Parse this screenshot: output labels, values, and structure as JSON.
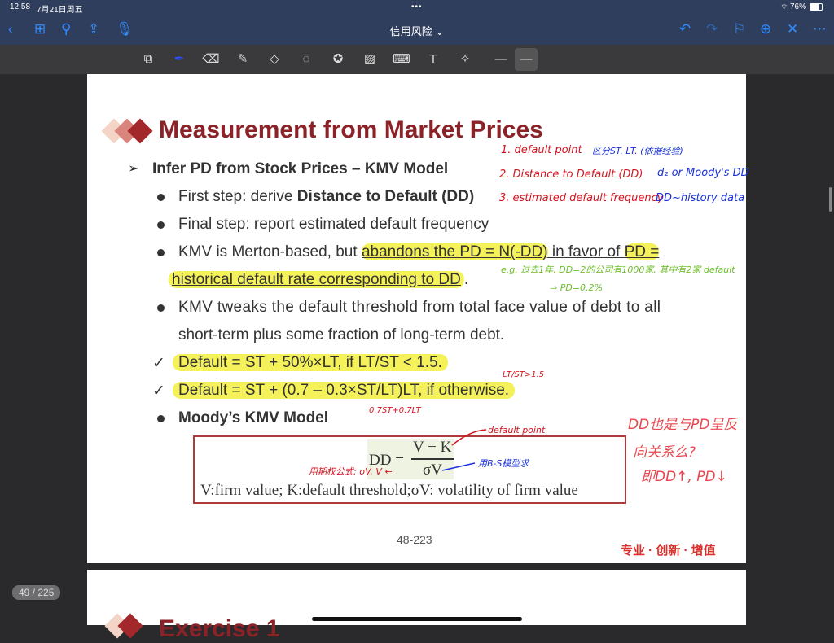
{
  "status": {
    "time": "12:58",
    "date": "7月21日周五",
    "battery": "76%"
  },
  "nav": {
    "title": "信用风险 ⌄"
  },
  "toolbar": {
    "colors": [
      "#ffffff",
      "#d40f0f",
      "#7ac943",
      "#1a1aff",
      "#b45cf5",
      "#ffffff",
      "#000000"
    ]
  },
  "slide": {
    "title": "Measurement from Market Prices",
    "subtitle": "Infer PD from Stock Prices – KMV Model",
    "b1_pre": "First step: derive ",
    "b1_bold": "Distance to Default (DD)",
    "b2": "Final step: report estimated default frequency",
    "b3_a": "KMV is Merton-based, but ",
    "b3_hl1": "abandons the PD = N(-DD)",
    "b3_b": " in favor of ",
    "b3_hl2": "PD =",
    "b3_hl3": "historical default rate corresponding to DD",
    "b4_1": "KMV tweaks the default threshold from total face value of debt to all",
    "b4_2": "short-term plus some fraction of long-term debt.",
    "c1": "Default = ST + 50%×LT, if LT/ST < 1.5.",
    "c2": "Default = ST + (0.7 – 0.3×ST/LT)LT, if otherwise.",
    "b5": "Moody’s KMV Model",
    "formula_lhs": "DD =",
    "formula_num": "V − K",
    "formula_den": "σV",
    "formula_caption": "V:firm value; K:default threshold;σV: volatility of firm value",
    "page_no": "48-223",
    "footer": "专业 · 创新 · 增值"
  },
  "notes": {
    "n1a": "1. default point",
    "n1b": "区分ST. LT. (依据经验)",
    "n2a": "2. Distance to Default (DD)",
    "n2b": "d₂ or Moody's DD",
    "n3a": "3. estimated default frequency",
    "n3b": "DD~history data",
    "n4": "e.g. 过去1年, DD=2的公司有1000家, 其中有2家 default",
    "n5": "⇒ PD=0.2%",
    "n6": "LT/ST>1.5",
    "n7": "0.7ST+0.7LT",
    "n8": "default point",
    "n9": "用B-S模型求",
    "n10": "用期权公式: σV, V ←",
    "n11": "DD也是与PD呈反",
    "n12": "向关系么?",
    "n13": "即DD↑, PD↓"
  },
  "page_counter": "49 / 225",
  "page2_title": "Exercise 1"
}
